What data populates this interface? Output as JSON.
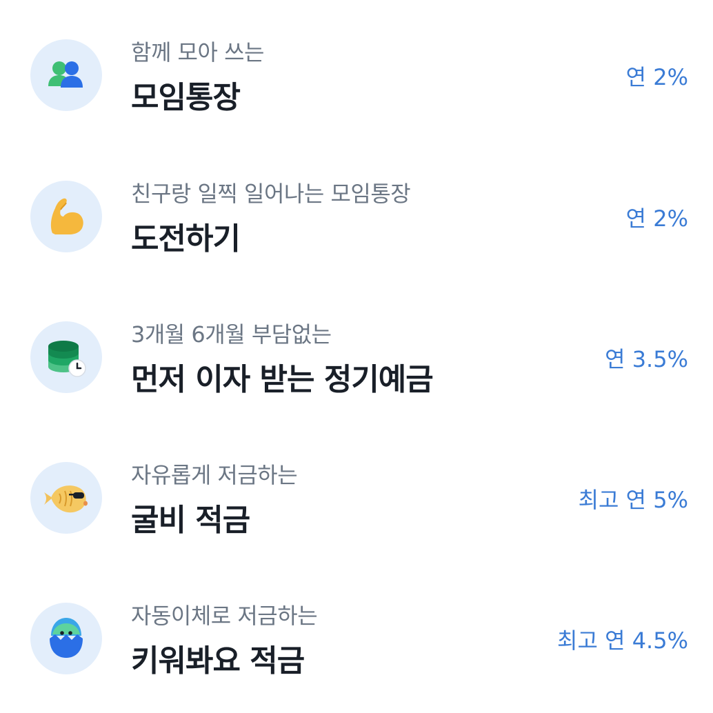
{
  "products": [
    {
      "subtitle": "함께 모아 쓰는",
      "title": "모임통장",
      "rate": "연 2%",
      "icon": "people-group-icon"
    },
    {
      "subtitle": "친구랑 일찍 일어나는 모임통장",
      "title": "도전하기",
      "rate": "연 2%",
      "icon": "flexed-bicep-icon"
    },
    {
      "subtitle": "3개월 6개월 부담없는",
      "title": "먼저 이자 받는 정기예금",
      "rate": "연 3.5%",
      "icon": "coin-stack-clock-icon"
    },
    {
      "subtitle": "자유롭게 저금하는",
      "title": "굴비 적금",
      "rate": "최고 연 5%",
      "icon": "fish-sunglasses-icon"
    },
    {
      "subtitle": "자동이체로 저금하는",
      "title": "키워봐요 적금",
      "rate": "최고 연 4.5%",
      "icon": "hatching-egg-icon"
    }
  ],
  "colors": {
    "rate_text": "#3a7bd5",
    "subtitle_text": "#6b7684",
    "title_text": "#191f28",
    "icon_background": "#e3eefb"
  }
}
